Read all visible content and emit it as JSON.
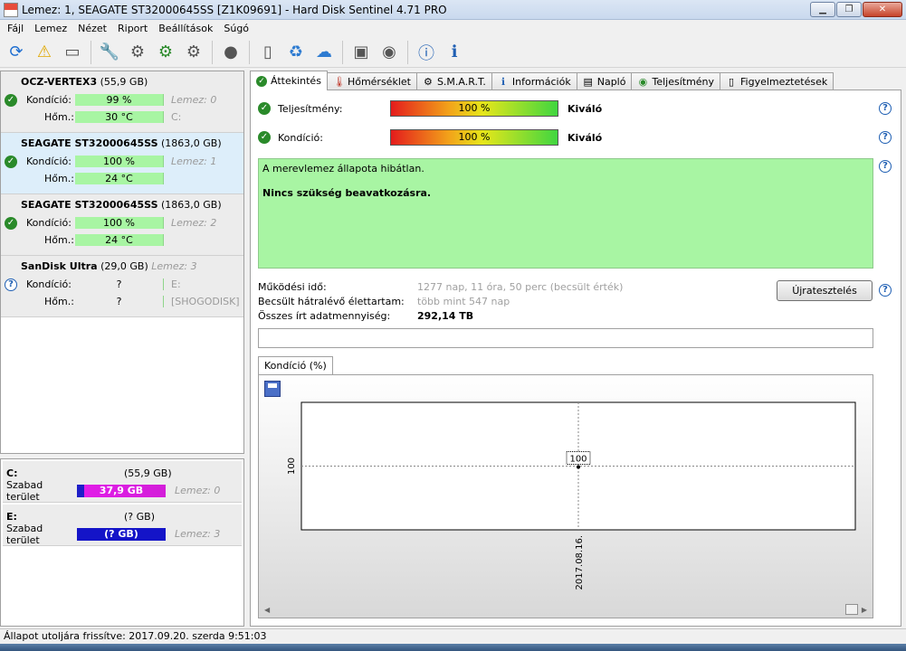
{
  "window": {
    "title": "Lemez: 1, SEAGATE ST32000645SS [Z1K09691]  -  Hard Disk Sentinel 4.71 PRO"
  },
  "menu": [
    "Fájl",
    "Lemez",
    "Nézet",
    "Riport",
    "Beállítások",
    "Súgó"
  ],
  "toolbar_icons": [
    "refresh-icon",
    "warning-icon",
    "disk-icon",
    "wrench-icon",
    "satellite-icon",
    "satellite-green-icon",
    "satellite-alt-icon",
    "circle-icon",
    "document-icon",
    "recycle-icon",
    "network-icon",
    "monitor-icon",
    "speaker-icon",
    "help-icon",
    "info-icon"
  ],
  "disks": [
    {
      "name": "OCZ-VERTEX3",
      "size": "(55,9 GB)",
      "status": "ok",
      "kond_label": "Kondíció:",
      "kond": "99 %",
      "kond_side": "Lemez: 0",
      "hom_label": "Hőm.:",
      "hom": "30 °C",
      "hom_side": "C:"
    },
    {
      "name": "SEAGATE ST32000645SS",
      "size": "(1863,0 GB)",
      "status": "ok",
      "kond_label": "Kondíció:",
      "kond": "100 %",
      "kond_side": "Lemez: 1",
      "hom_label": "Hőm.:",
      "hom": "24 °C",
      "hom_side": ""
    },
    {
      "name": "SEAGATE ST32000645SS",
      "size": "(1863,0 GB)",
      "status": "ok",
      "kond_label": "Kondíció:",
      "kond": "100 %",
      "kond_side": "Lemez: 2",
      "hom_label": "Hőm.:",
      "hom": "24 °C",
      "hom_side": ""
    },
    {
      "name": "SanDisk Ultra",
      "size": "(29,0 GB)",
      "size_extra": "Lemez: 3",
      "status": "unknown",
      "kond_label": "Kondíció:",
      "kond": "?",
      "kond_side": "E:",
      "hom_label": "Hőm.:",
      "hom": "?",
      "hom_side": "[SHOGODISK]"
    }
  ],
  "partitions": [
    {
      "drive": "C:",
      "size": "(55,9 GB)",
      "free_label": "Szabad terület",
      "free": "37,9 GB",
      "disk": "Lemez: 0"
    },
    {
      "drive": "E:",
      "size": "(? GB)",
      "free_label": "Szabad terület",
      "free": "(? GB)",
      "disk": "Lemez: 3"
    }
  ],
  "tabs": [
    "Áttekintés",
    "Hőmérséklet",
    "S.M.A.R.T.",
    "Információk",
    "Napló",
    "Teljesítmény",
    "Figyelmeztetések"
  ],
  "overview": {
    "perf_label": "Teljesítmény:",
    "perf_value": "100 %",
    "perf_verdict": "Kiváló",
    "cond_label": "Kondíció:",
    "cond_value": "100 %",
    "cond_verdict": "Kiváló",
    "status_line1": "A merevlemez állapota hibátlan.",
    "status_line2": "Nincs szükség beavatkozásra.",
    "uptime_label": "Működési idő:",
    "uptime_value": "1277 nap, 11 óra, 50 perc (becsült érték)",
    "remaining_label": "Becsült hátralévő élettartam:",
    "remaining_value": "több mint 547 nap",
    "written_label": "Összes írt adatmennyiség:",
    "written_value": "292,14 TB",
    "retest_button": "Újratesztelés",
    "help": "?"
  },
  "chart_tab": "Kondíció  (%)",
  "chart_data": {
    "type": "line",
    "x": [
      "2017.08.16."
    ],
    "series": [
      {
        "values": [
          100
        ]
      }
    ],
    "ylabel_tick": "100",
    "point_label": "100",
    "grid": true
  },
  "statusbar": "Állapot utoljára frissítve: 2017.09.20. szerda 9:51:03"
}
